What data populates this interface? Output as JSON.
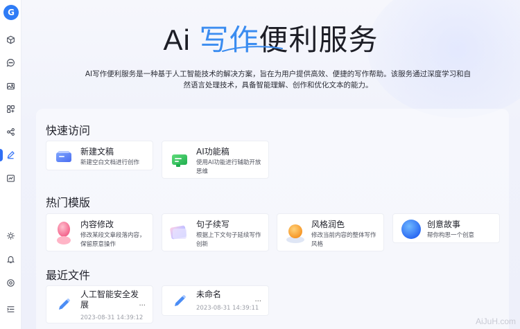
{
  "colors": {
    "accent": "#2f6ff5",
    "hero_highlight": "#3a8cf0"
  },
  "sidebar": {
    "logo": "G",
    "icons": [
      "cube-icon",
      "chat-icon",
      "image-icon",
      "apps-icon",
      "share-icon",
      "pen-icon",
      "chart-icon",
      "sun-icon",
      "bell-icon",
      "settings-icon",
      "collapse-icon"
    ],
    "active": "pen-icon"
  },
  "hero": {
    "title_pre": "Ai ",
    "title_highlight": "写作",
    "title_post": "便利服务",
    "description": "AI写作便利服务是一种基于人工智能技术的解决方案，旨在为用户提供高效、便捷的写作帮助。该服务通过深度学习和自然语言处理技术，具备智能理解、创作和优化文本的能力。"
  },
  "quick_access": {
    "title": "快速访问",
    "items": [
      {
        "title": "新建文稿",
        "desc": "新建空白文档进行创作"
      },
      {
        "title": "AI功能稿",
        "desc": "使用AI功能进行辅助开放思维"
      }
    ]
  },
  "templates": {
    "title": "热门模版",
    "items": [
      {
        "title": "内容修改",
        "desc": "修改某段文章段落内容，保留原意操作"
      },
      {
        "title": "句子续写",
        "desc": "根据上下文句子延续写作创新"
      },
      {
        "title": "风格润色",
        "desc": "修改当前内容的整体写作风格"
      },
      {
        "title": "创意故事",
        "desc": "帮你构思一个创意"
      }
    ]
  },
  "recent": {
    "title": "最近文件",
    "items": [
      {
        "title": "人工智能安全发展",
        "date": "2023-08-31 14:39:12",
        "more": "..."
      },
      {
        "title": "未命名",
        "date": "2023-08-31 14:39:11",
        "more": "..."
      }
    ]
  },
  "watermark": "AiJuH.com"
}
